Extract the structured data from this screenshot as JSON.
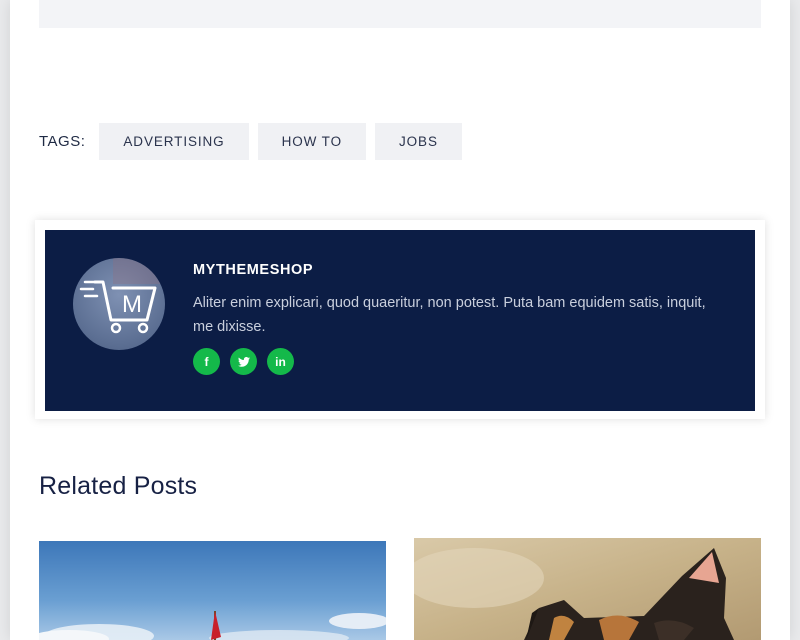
{
  "tags": {
    "label": "TAGS:",
    "items": [
      "ADVERTISING",
      "HOW TO",
      "JOBS"
    ]
  },
  "author": {
    "name": "MYTHEMESHOP",
    "bio": "Aliter enim explicari, quod quaeritur, non potest. Puta bam equidem satis, inquit, me dixisse.",
    "avatar_letter": "M",
    "socials": [
      {
        "icon": "facebook-icon",
        "glyph": "f"
      },
      {
        "icon": "twitter-icon",
        "glyph": "t"
      },
      {
        "icon": "linkedin-icon",
        "glyph": "in"
      }
    ]
  },
  "related": {
    "title": "Related Posts"
  },
  "colors": {
    "author_bg": "#0c1d45",
    "social_green": "#14b94a",
    "tag_bg": "#f0f1f4"
  }
}
